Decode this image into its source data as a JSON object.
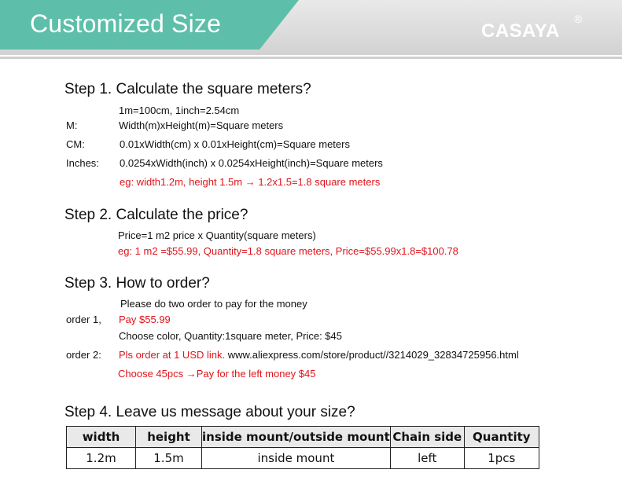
{
  "header": {
    "title": "Customized Size",
    "brand": "CASAYA",
    "registered": "®"
  },
  "step1": {
    "title": "Step 1. Calculate the square meters?",
    "conversion": "1m=100cm, 1inch=2.54cm",
    "m_label": "M:",
    "m_formula": "Width(m)xHeight(m)=Square meters",
    "cm_label": "CM:",
    "cm_formula": "0.01xWidth(cm) x 0.01xHeight(cm)=Square meters",
    "in_label": "Inches:",
    "in_formula": "0.0254xWidth(inch) x 0.0254xHeight(inch)=Square meters",
    "example": "eg: width1.2m, height 1.5m → 1.2x1.5=1.8 square meters"
  },
  "step2": {
    "title": "Step 2. Calculate the price?",
    "formula": "Price=1 m2 price x Quantity(square meters)",
    "example": "eg: 1 m2 =$55.99, Quantity=1.8 square meters, Price=$55.99x1.8=$100.78"
  },
  "step3": {
    "title": "Step 3. How to order?",
    "intro": "Please do two order to pay for the money",
    "order1_label": "order 1,",
    "order1_pay": "Pay $55.99",
    "order1_desc": "Choose color,  Quantity:1square meter, Price: $45",
    "order2_label": "order 2:",
    "order2_red": "Pls order at 1 USD link.",
    "order2_link": " www.aliexpress.com/store/product//3214029_32834725956.html",
    "order2_note": "Choose 45pcs  →Pay for the left money $45"
  },
  "step4": {
    "title": "Step 4. Leave us message about your size?",
    "table": {
      "headers": [
        "width",
        "height",
        "inside mount/outside mount",
        "Chain side",
        "Quantity"
      ],
      "row": [
        "1.2m",
        "1.5m",
        "inside mount",
        "left",
        "1pcs"
      ]
    }
  },
  "colors": {
    "accent_teal": "#5dbfa9",
    "highlight_red": "#e0141b"
  }
}
